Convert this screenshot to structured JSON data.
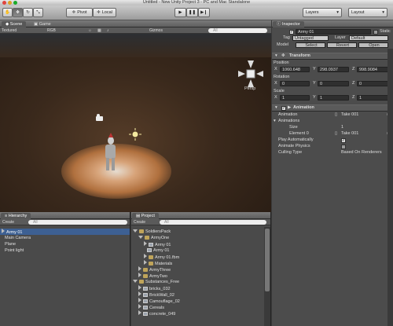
{
  "window": {
    "title": "Untitled - New Unity Project 3 - PC and Mac Standalone"
  },
  "toolbar": {
    "pivot": "Pivot",
    "local": "Local",
    "layers": "Layers",
    "layout": "Layout"
  },
  "scene": {
    "tabs": [
      "Scene",
      "Game"
    ],
    "render_mode": "Textured",
    "color_mode": "RGB",
    "gizmos": "Gizmos",
    "search_placeholder": "All",
    "persp_label": "Persp"
  },
  "hierarchy": {
    "tab": "Hierarchy",
    "create": "Create",
    "search_placeholder": "All",
    "items": [
      "Army 01",
      "Main Camera",
      "Plane",
      "Point light"
    ]
  },
  "project": {
    "tab": "Project",
    "create": "Create",
    "search_placeholder": "All",
    "items": [
      "SoldiersPack",
      "ArmyOne",
      "Army 01",
      "Army 01",
      "Army 01.fbm",
      "Materials",
      "ArmyThree",
      "ArmyTwo",
      "Substances_Free",
      "bricks_032",
      "BrickWall_02",
      "Camouflage_02",
      "Cereals",
      "concrete_049"
    ]
  },
  "inspector": {
    "tab": "Inspector",
    "object_name": "Army 01",
    "static_label": "Static",
    "tag_label": "Tag",
    "tag_value": "Untagged",
    "layer_label": "Layer",
    "layer_value": "Default",
    "model_label": "Model",
    "model_buttons": [
      "Select",
      "Revert",
      "Open"
    ],
    "transform": {
      "title": "Transform",
      "position_label": "Position",
      "position": {
        "x": "1060.648",
        "y": "298.0937",
        "z": "998.9084"
      },
      "rotation_label": "Rotation",
      "rotation": {
        "x": "0",
        "y": "0",
        "z": "0"
      },
      "scale_label": "Scale",
      "scale": {
        "x": "1",
        "y": "1",
        "z": "1"
      }
    },
    "animation": {
      "title": "Animation",
      "animation_label": "Animation",
      "animation_value": "Take 001",
      "animations_label": "Animations",
      "size_label": "Size",
      "size_value": "1",
      "element_label": "Element 0",
      "element_value": "Take 001",
      "play_auto_label": "Play Automatically",
      "play_auto": true,
      "animate_physics_label": "Animate Physics",
      "animate_physics": false,
      "culling_label": "Culling Type",
      "culling_value": "Based On Renderers"
    }
  },
  "colors": {
    "selection": "#3d6093",
    "accent_light": "#f4e9a0"
  }
}
